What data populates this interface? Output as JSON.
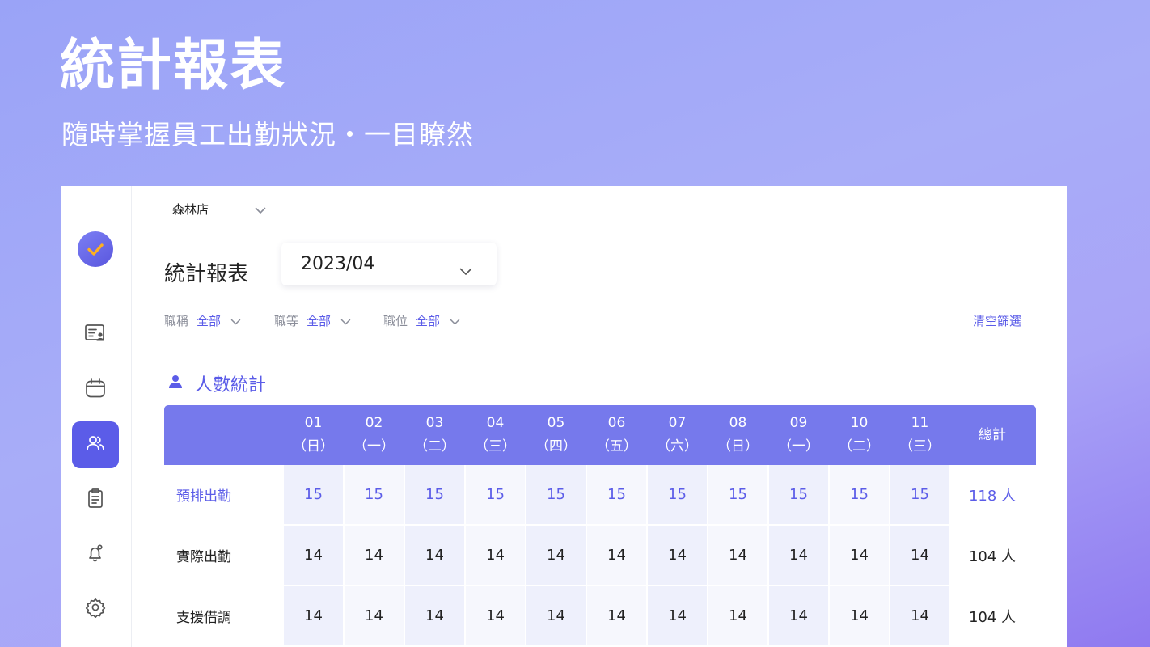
{
  "hero": {
    "title": "統計報表",
    "subtitle": "隨時掌握員工出勤狀況・一目瞭然"
  },
  "app": {
    "sidebar": {
      "logo_icon": "check-logo-icon",
      "nav": [
        {
          "icon": "employee-card-icon",
          "active": false
        },
        {
          "icon": "calendar-icon",
          "active": false
        },
        {
          "icon": "users-icon",
          "active": true
        },
        {
          "icon": "clipboard-icon",
          "active": false
        },
        {
          "icon": "bell-icon",
          "active": false
        },
        {
          "icon": "gear-icon",
          "active": false
        }
      ]
    },
    "topbar": {
      "store": "森林店"
    },
    "page_title": "統計報表",
    "month": "2023/04",
    "filters": [
      {
        "label": "職稱",
        "value": "全部"
      },
      {
        "label": "職等",
        "value": "全部"
      },
      {
        "label": "職位",
        "value": "全部"
      }
    ],
    "clear_filter": "清空篩選",
    "section_title": "人數統計",
    "accent_color": "#5b5ce8",
    "table": {
      "columns": [
        {
          "day": "01",
          "weekday": "（日）"
        },
        {
          "day": "02",
          "weekday": "（一）"
        },
        {
          "day": "03",
          "weekday": "（二）"
        },
        {
          "day": "04",
          "weekday": "（三）"
        },
        {
          "day": "05",
          "weekday": "（四）"
        },
        {
          "day": "06",
          "weekday": "（五）"
        },
        {
          "day": "07",
          "weekday": "（六）"
        },
        {
          "day": "08",
          "weekday": "（日）"
        },
        {
          "day": "09",
          "weekday": "（一）"
        },
        {
          "day": "10",
          "weekday": "（二）"
        },
        {
          "day": "11",
          "weekday": "（三）"
        }
      ],
      "total_header": "總計",
      "rows": [
        {
          "label": "預排出勤",
          "values": [
            "15",
            "15",
            "15",
            "15",
            "15",
            "15",
            "15",
            "15",
            "15",
            "15",
            "15"
          ],
          "total": "118 人"
        },
        {
          "label": "實際出勤",
          "values": [
            "14",
            "14",
            "14",
            "14",
            "14",
            "14",
            "14",
            "14",
            "14",
            "14",
            "14"
          ],
          "total": "104 人"
        },
        {
          "label": "支援借調",
          "values": [
            "14",
            "14",
            "14",
            "14",
            "14",
            "14",
            "14",
            "14",
            "14",
            "14",
            "14"
          ],
          "total": "104 人"
        }
      ]
    }
  }
}
